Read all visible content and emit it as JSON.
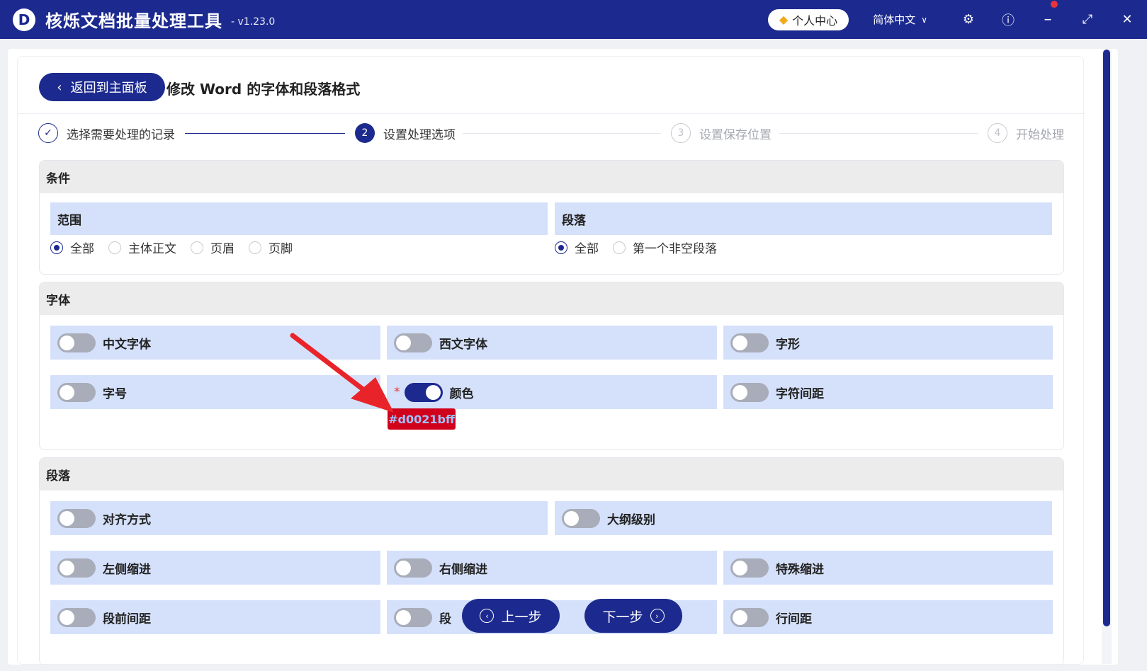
{
  "app": {
    "title": "核烁文档批量处理工具",
    "version": "- v1.23.0",
    "logo_letter": "D"
  },
  "titlebar": {
    "user_center": "个人中心",
    "language": "简体中文"
  },
  "header": {
    "back_label": "返回到主面板",
    "page_title": "修改 Word 的字体和段落格式"
  },
  "steps": [
    {
      "num": "",
      "label": "选择需要处理的记录",
      "state": "done"
    },
    {
      "num": "2",
      "label": "设置处理选项",
      "state": "active"
    },
    {
      "num": "3",
      "label": "设置保存位置",
      "state": "todo"
    },
    {
      "num": "4",
      "label": "开始处理",
      "state": "todo"
    }
  ],
  "conditions": {
    "title": "条件",
    "scope": {
      "title": "范围",
      "options": [
        "全部",
        "主体正文",
        "页眉",
        "页脚"
      ],
      "selected": "全部"
    },
    "paragraph": {
      "title": "段落",
      "options": [
        "全部",
        "第一个非空段落"
      ],
      "selected": "全部"
    }
  },
  "font": {
    "title": "字体",
    "options": [
      {
        "label": "中文字体",
        "on": false
      },
      {
        "label": "西文字体",
        "on": false
      },
      {
        "label": "字形",
        "on": false
      },
      {
        "label": "字号",
        "on": false
      },
      {
        "label": "颜色",
        "on": true,
        "required": "*"
      },
      {
        "label": "字符间距",
        "on": false
      }
    ],
    "color_value": "#d0021bff"
  },
  "paragraph_section": {
    "title": "段落",
    "options": [
      {
        "label": "对齐方式",
        "on": false
      },
      {
        "label": "大纲级别",
        "on": false
      },
      {
        "label": "左侧缩进",
        "on": false
      },
      {
        "label": "右侧缩进",
        "on": false
      },
      {
        "label": "特殊缩进",
        "on": false
      },
      {
        "label": "段前间距",
        "on": false
      },
      {
        "label": "段",
        "on": false
      },
      {
        "label": "行间距",
        "on": false
      }
    ]
  },
  "nav": {
    "prev_label": "上一步",
    "next_label": "下一步"
  },
  "colors": {
    "brand": "#1c2a8f",
    "option_bg": "#d5e1fb",
    "annotation_arrow": "#e8242a",
    "chip_bg": "#d0021b"
  }
}
